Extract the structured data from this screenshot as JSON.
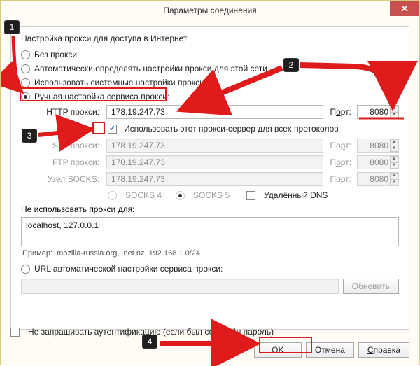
{
  "window": {
    "title": "Параметры соединения"
  },
  "heading": "Настройка прокси для доступа в Интернет",
  "radios": {
    "none": "Без прокси",
    "auto": "Автоматически определять настройки прокси для этой сети",
    "system": "Использовать системные настройки прокси",
    "manual": "Ручная настройка сервиса прокси:",
    "url": "URL автоматической настройки сервиса прокси:"
  },
  "rows": {
    "http": {
      "label": "HTTP прокси:",
      "value": "178.19.247.73",
      "portlabel_pref": "П",
      "portlabel_u": "о",
      "portlabel_suf": "рт:",
      "port": "8080"
    },
    "ssl": {
      "label": "SSL прокси:",
      "value": "178.19.247.73",
      "portlabel_pref": "По",
      "portlabel_u": "р",
      "portlabel_suf": "т:",
      "port": "8080"
    },
    "ftp": {
      "label": "FTP прокси:",
      "value": "178.19.247.73",
      "portlabel_pref": "П",
      "portlabel_u": "о",
      "portlabel_suf": "рт:",
      "port": "8080"
    },
    "socks": {
      "label": "Узел SOCKS:",
      "value": "178.19.247.73",
      "portlabel_pref": "Пор",
      "portlabel_u": "т",
      "portlabel_suf": ":",
      "port": "8080"
    }
  },
  "useAll": "Использовать этот прокси-сервер для всех протоколов",
  "socks4": "SOCKS 4",
  "socks5": "SOCKS 5",
  "remoteDns": {
    "pref": "Уда",
    "u": "л",
    "suf": "ённый DNS"
  },
  "noProxyLabel": "Не использовать прокси для:",
  "noProxyValue": "localhost, 127.0.0.1",
  "example": "Пример: .mozilla-russia.org, .net.nz, 192.168.1.0/24",
  "reload": "Обновить",
  "noauth": "Не запрашивать аутентификацию (если был сохранён пароль)",
  "buttons": {
    "ok": "OK",
    "cancel": "Отмена",
    "help": {
      "u": "С",
      "rest": "правка"
    }
  },
  "callouts": {
    "c1": "1",
    "c2": "2",
    "c3": "3",
    "c4": "4"
  }
}
